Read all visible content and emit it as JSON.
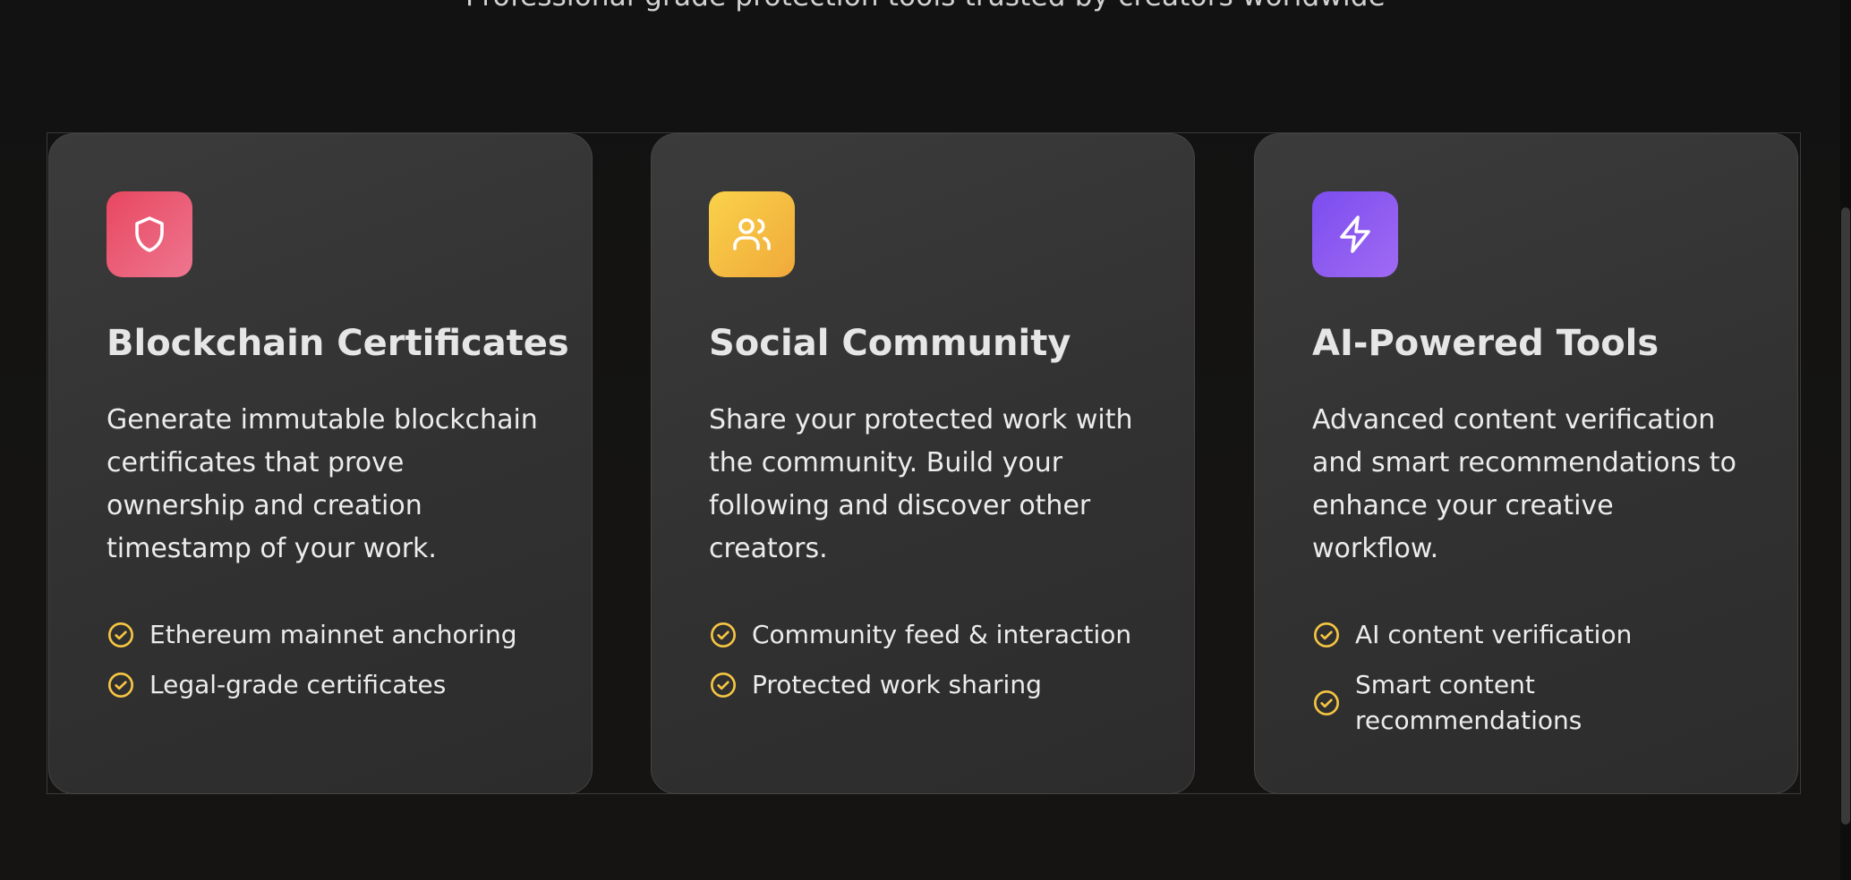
{
  "section": {
    "subtitle": "Professional-grade protection tools trusted by creators worldwide"
  },
  "cards": [
    {
      "icon": "shield-icon",
      "icon_color": "#e8475f",
      "title": "Blockchain Certificates",
      "description": "Generate immutable blockchain certificates that prove ownership and creation timestamp of your work.",
      "features": [
        "Ethereum mainnet anchoring",
        "Legal-grade certificates"
      ]
    },
    {
      "icon": "users-icon",
      "icon_color": "#f5c242",
      "title": "Social Community",
      "description": "Share your protected work with the community. Build your following and discover other creators.",
      "features": [
        "Community feed & interaction",
        "Protected work sharing"
      ]
    },
    {
      "icon": "lightning-icon",
      "icon_color": "#8b5cf6",
      "title": "AI-Powered Tools",
      "description": "Advanced content verification and smart recommendations to enhance your creative workflow.",
      "features": [
        "AI content verification",
        "Smart content recommendations"
      ]
    }
  ],
  "colors": {
    "background": "#111010",
    "card": "#333333",
    "check": "#f5c542"
  }
}
